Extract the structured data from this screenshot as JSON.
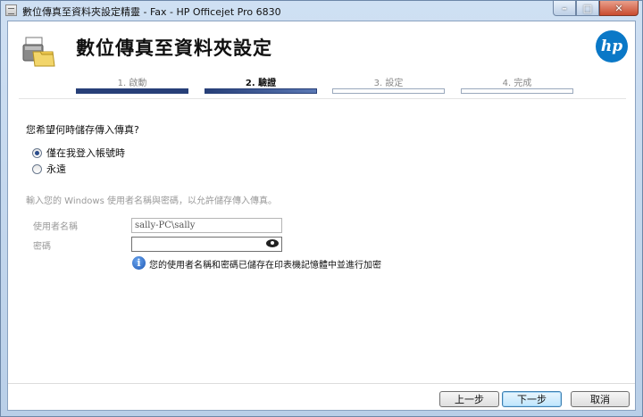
{
  "window": {
    "title": "數位傳真至資料夾設定精靈 - Fax - HP Officejet Pro 6830",
    "minimize_glyph": "–",
    "maximize_glyph": "□",
    "close_glyph": "✕"
  },
  "header": {
    "title": "數位傳真至資料夾設定",
    "icon": "folder-fax-icon",
    "logo_text": "hp"
  },
  "steps": [
    {
      "label": "1. 啟動",
      "state": "done"
    },
    {
      "label": "2. 驗證",
      "state": "current"
    },
    {
      "label": "3. 設定",
      "state": "pending"
    },
    {
      "label": "4. 完成",
      "state": "pending"
    }
  ],
  "form": {
    "question": "您希望何時儲存傳入傳真?",
    "options": [
      {
        "label": "僅在我登入帳號時",
        "selected": true
      },
      {
        "label": "永遠",
        "selected": false
      }
    ],
    "note": "輸入您的 Windows 使用者名稱與密碼，以允許儲存傳入傳真。",
    "username_label": "使用者名稱",
    "username_value": "sally-PC\\sally",
    "password_label": "密碼",
    "password_value": "",
    "info_text": "您的使用者名稱和密碼已儲存在印表機記憶體中並進行加密"
  },
  "buttons": {
    "back": "上一步",
    "next": "下一步",
    "cancel": "取消"
  },
  "colors": {
    "step_done": "#273f78",
    "hp_blue": "#0a78c7",
    "info_blue": "#1d57b4"
  }
}
